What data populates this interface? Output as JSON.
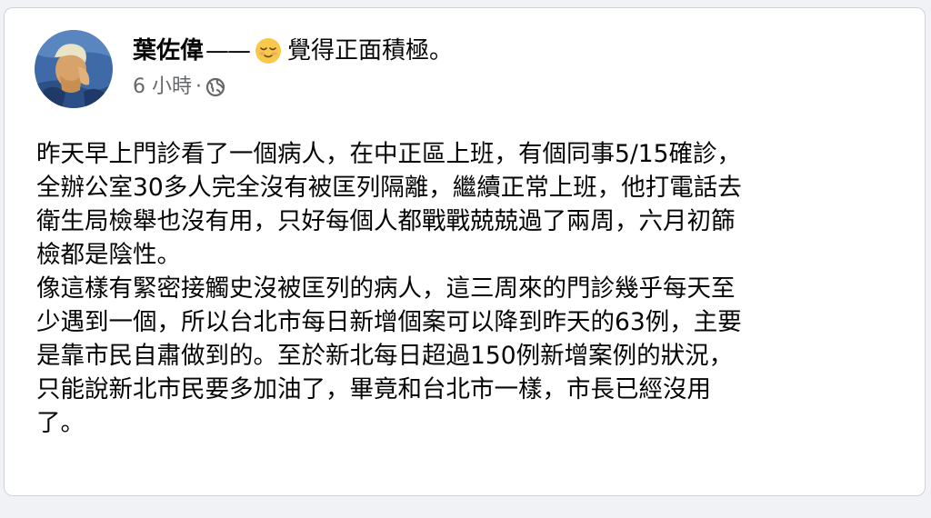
{
  "post": {
    "author": "葉佐偉",
    "dash": "——",
    "feeling_icon": "relieved-face-emoji",
    "feeling_text": "覺得正面積極。",
    "time": "6 小時",
    "separator": "·",
    "privacy_icon": "globe-icon",
    "paragraphs": [
      "昨天早上門診看了一個病人，在中正區上班，有個同事5/15確診，\n全辦公室30多人完全沒有被匡列隔離，繼續正常上班，他打電話去\n衛生局檢舉也沒有用，只好每個人都戰戰兢兢過了兩周，六月初篩\n檢都是陰性。",
      "像這樣有緊密接觸史沒被匡列的病人，這三周來的門診幾乎每天至\n少遇到一個，所以台北市每日新增個案可以降到昨天的63例，主要\n是靠市民自肅做到的。至於新北每日超過150例新增案例的狀況，\n只能說新北市民要多加油了，畢竟和台北市一樣，市長已經沒用\n了。"
    ]
  },
  "colors": {
    "background": "#f0f2f5",
    "card": "#ffffff",
    "text": "#050505",
    "secondary_text": "#65676b"
  }
}
